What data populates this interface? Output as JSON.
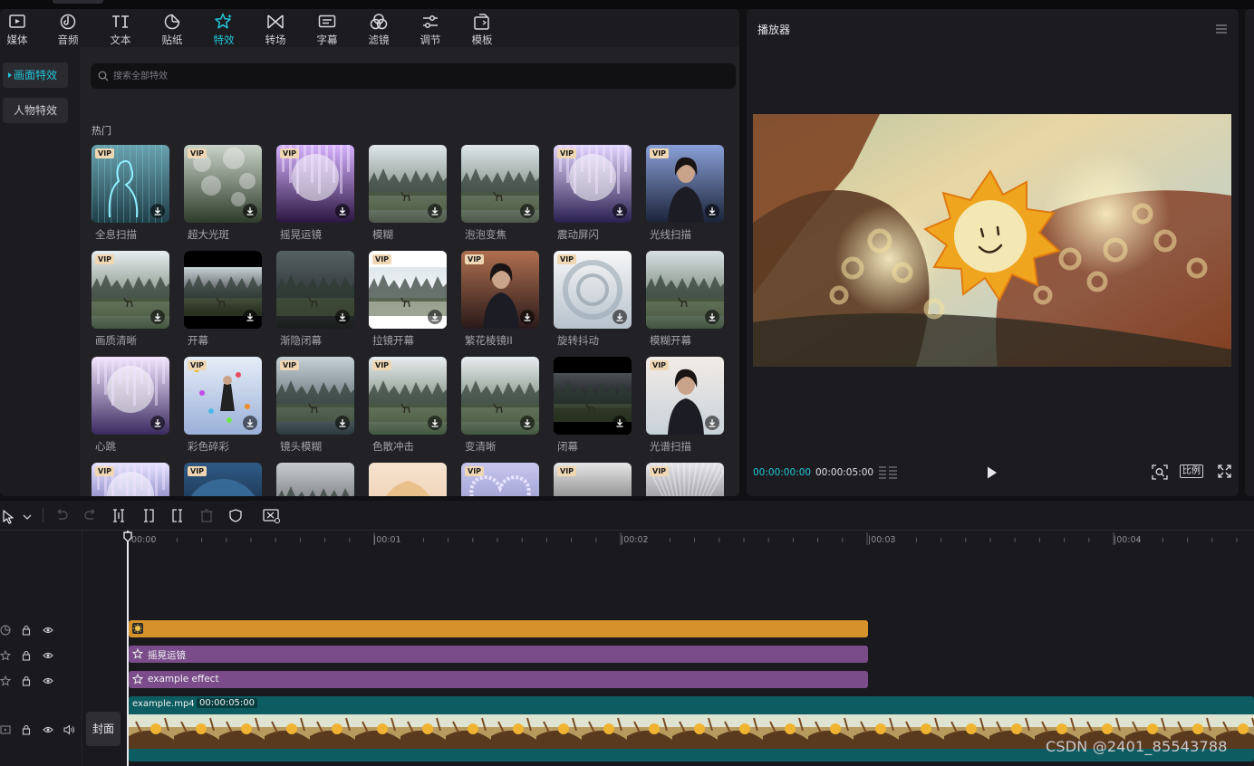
{
  "categories": [
    {
      "label": "媒体",
      "icon": "media-icon"
    },
    {
      "label": "音频",
      "icon": "audio-icon"
    },
    {
      "label": "文本",
      "icon": "text-icon"
    },
    {
      "label": "贴纸",
      "icon": "sticker-icon"
    },
    {
      "label": "特效",
      "icon": "effects-icon",
      "active": true
    },
    {
      "label": "转场",
      "icon": "transition-icon"
    },
    {
      "label": "字幕",
      "icon": "subtitle-icon"
    },
    {
      "label": "滤镜",
      "icon": "filter-icon"
    },
    {
      "label": "调节",
      "icon": "adjust-icon"
    },
    {
      "label": "模板",
      "icon": "template-icon"
    }
  ],
  "sidebar": {
    "items": [
      {
        "label": "画面特效",
        "active": true
      },
      {
        "label": "人物特效",
        "active": false
      }
    ]
  },
  "search": {
    "placeholder": "搜索全部特效"
  },
  "effects": {
    "section_title": "热门",
    "items": [
      {
        "label": "全息扫描",
        "vip": true
      },
      {
        "label": "超大光斑",
        "vip": true
      },
      {
        "label": "摇晃运镜",
        "vip": true
      },
      {
        "label": "模糊",
        "vip": false
      },
      {
        "label": "泡泡变焦",
        "vip": false
      },
      {
        "label": "震动屏闪",
        "vip": true
      },
      {
        "label": "光线扫描",
        "vip": true
      },
      {
        "label": "画质清晰",
        "vip": true
      },
      {
        "label": "开幕",
        "vip": false
      },
      {
        "label": "渐隐闭幕",
        "vip": false
      },
      {
        "label": "拉镜开幕",
        "vip": true
      },
      {
        "label": "繁花棱镜II",
        "vip": true
      },
      {
        "label": "旋转抖动",
        "vip": true
      },
      {
        "label": "模糊开幕",
        "vip": false
      },
      {
        "label": "心跳",
        "vip": false
      },
      {
        "label": "彩色碎彩",
        "vip": true
      },
      {
        "label": "镜头模糊",
        "vip": true
      },
      {
        "label": "色散冲击",
        "vip": true
      },
      {
        "label": "变清晰",
        "vip": false
      },
      {
        "label": "闭幕",
        "vip": false
      },
      {
        "label": "光谱扫描",
        "vip": true
      },
      {
        "label": "",
        "vip": true
      },
      {
        "label": "",
        "vip": true
      },
      {
        "label": "",
        "vip": false
      },
      {
        "label": "",
        "vip": false
      },
      {
        "label": "",
        "vip": true
      },
      {
        "label": "",
        "vip": true
      },
      {
        "label": "",
        "vip": true
      }
    ],
    "vip_badge": "VIP"
  },
  "player": {
    "title": "播放器",
    "current_time": "00:00:00:00",
    "total_time": "00:00:05:00",
    "ratio_label": "比例"
  },
  "timeline": {
    "ruler_labels": [
      "00:00",
      "|00:01",
      "|00:02",
      "|00:03",
      "|00:04"
    ],
    "cover_label": "封面",
    "clips": {
      "fx1_label": "摇晃运镜",
      "fx2_label": "example effect",
      "video_name": "example.mp4",
      "video_duration": "00:00:05:00"
    }
  },
  "watermark": "CSDN @2401_85543788",
  "colors": {
    "accent": "#22c7d8",
    "sticker_clip": "#d5912a",
    "effect_clip": "#7a4c8a",
    "video_clip": "#0c5c62"
  }
}
